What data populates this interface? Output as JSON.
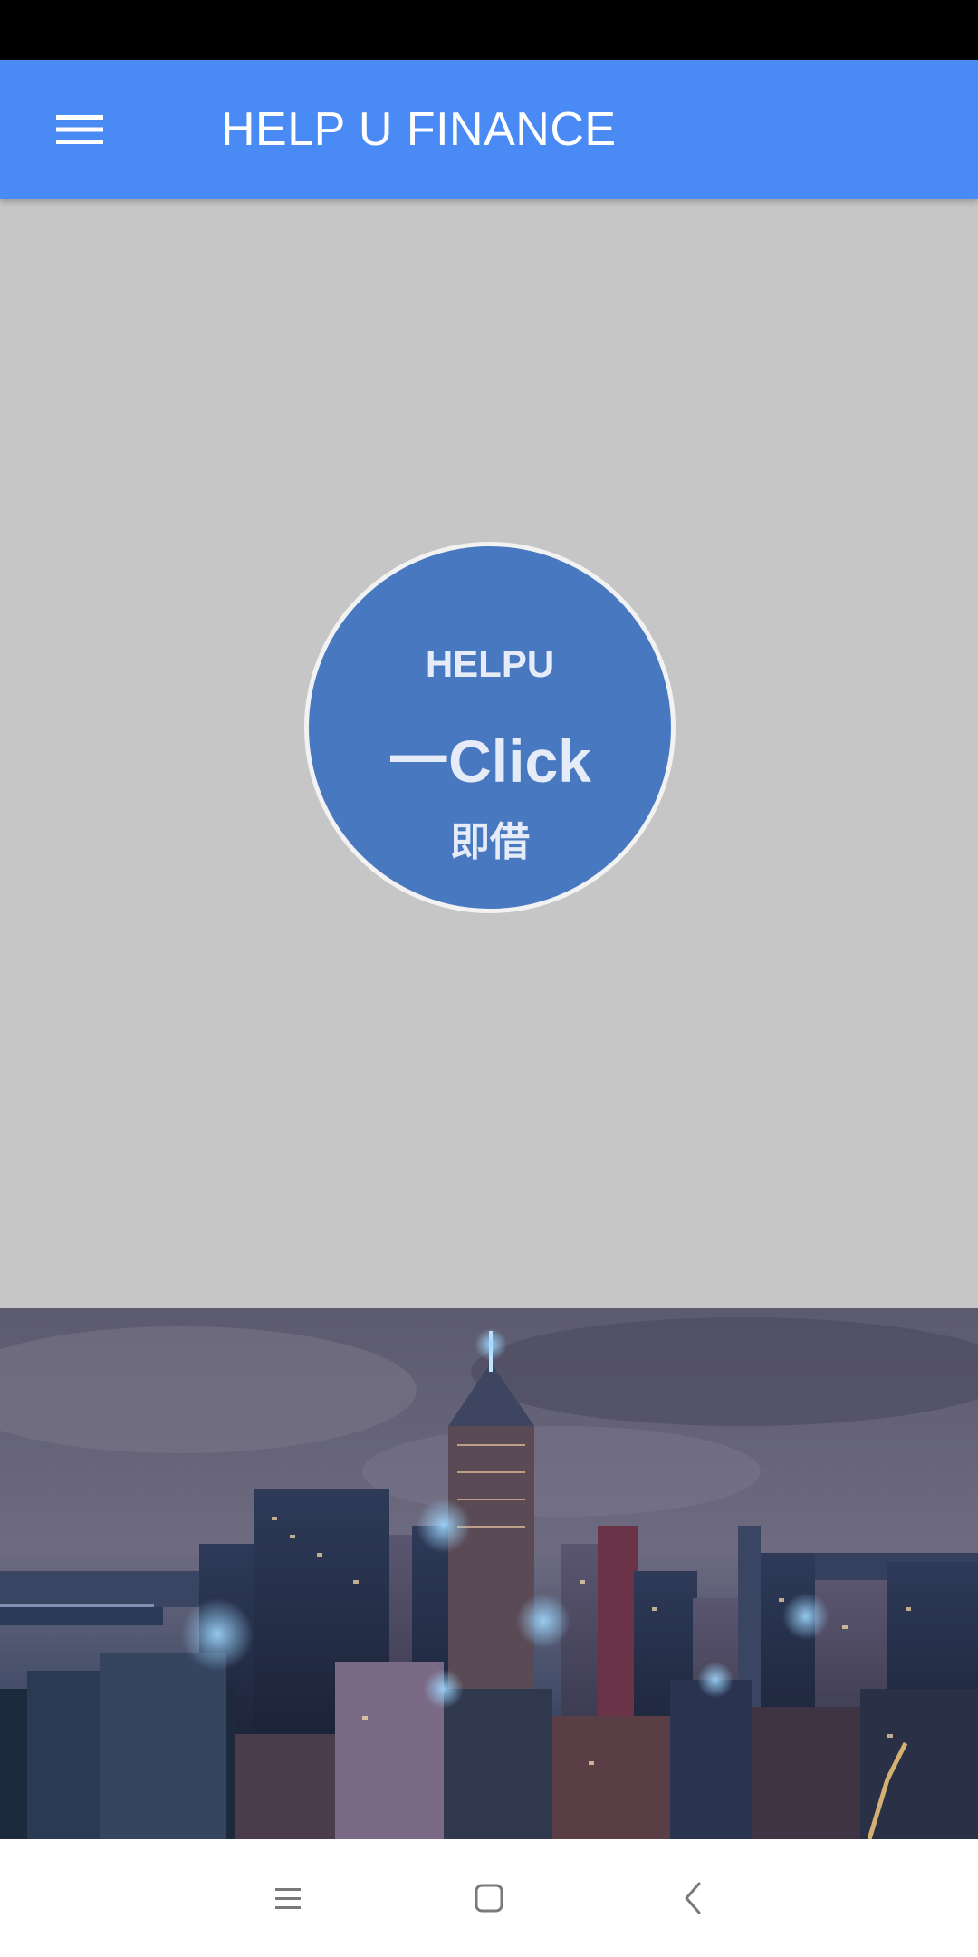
{
  "app_bar": {
    "title": "HELP U FINANCE",
    "menu_icon": "hamburger-menu-icon",
    "background_color": "#4a8af4"
  },
  "main": {
    "background_color": "#c6c6c6",
    "loan_button": {
      "line1": "HELPU",
      "line2": "一Click",
      "line3": "即借",
      "fill_color": "#4878c0",
      "text_color": "#e6ecf7"
    }
  },
  "banner": {
    "image": "night-city-skyline"
  },
  "system_nav": {
    "recent_icon": "recent-apps-icon",
    "home_icon": "home-square-icon",
    "back_icon": "back-chevron-icon"
  }
}
